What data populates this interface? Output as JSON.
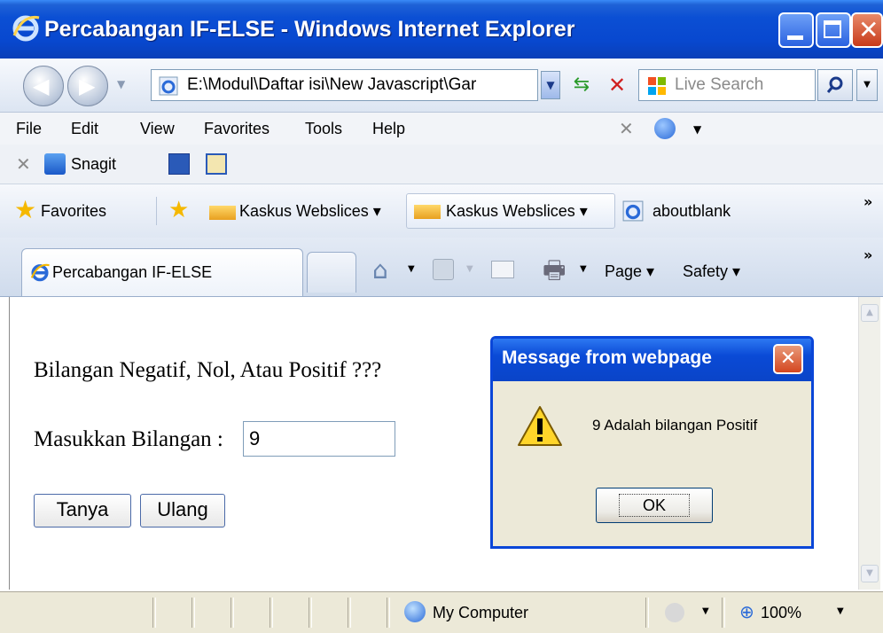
{
  "window": {
    "title": "Percabangan IF-ELSE - Windows Internet Explorer"
  },
  "navigation": {
    "address": "E:\\Modul\\Daftar isi\\New Javascript\\Gar",
    "search_placeholder": "Live Search"
  },
  "menu": {
    "items": [
      "File",
      "Edit",
      "View",
      "Favorites",
      "Tools",
      "Help"
    ]
  },
  "snagit_bar": {
    "label": "Snagit"
  },
  "favorites_bar": {
    "favorites_label": "Favorites",
    "items": [
      {
        "label": "Kaskus Webslices ▾"
      },
      {
        "label": "Kaskus Webslices ▾"
      },
      {
        "label": "aboutblank"
      }
    ]
  },
  "tabs": {
    "active_tab": "Percabangan IF-ELSE"
  },
  "toolbar": {
    "page_label": "Page ▾",
    "safety_label": "Safety ▾"
  },
  "page": {
    "heading": "Bilangan Negatif, Nol, Atau Positif ???",
    "input_label": "Masukkan Bilangan :",
    "input_value": "9",
    "ask_button": "Tanya",
    "reset_button": "Ulang"
  },
  "dialog": {
    "title": "Message from webpage",
    "message": "9  Adalah bilangan Positif",
    "ok_button": "OK"
  },
  "statusbar": {
    "zone": "My Computer",
    "zoom": "100%"
  },
  "colors": {
    "titlebar": "#0848cf",
    "dialog_border": "#0a46d8",
    "dialog_bg": "#ece9d8"
  }
}
